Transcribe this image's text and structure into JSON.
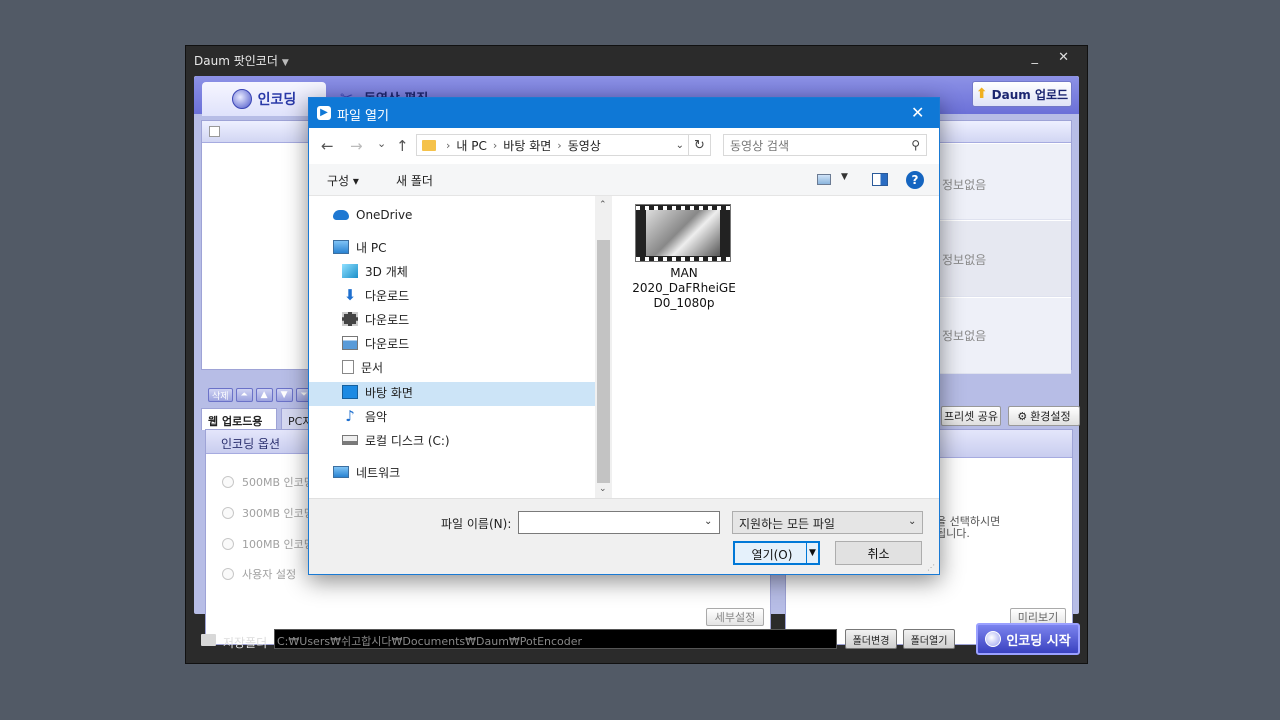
{
  "app": {
    "title": "Daum 팟인코더",
    "title_caret": "▼",
    "controls": "_ ✕",
    "tabs": {
      "encoding": "인코딩",
      "edit": "동영상 편집"
    },
    "daum_upload": "Daum 업로드",
    "list_info": [
      "정보없음",
      "정보없음",
      "정보없음"
    ],
    "list_buttons": {
      "delete": "삭제",
      "up_top": "⏶",
      "up": "▲",
      "down": "▼",
      "down_bottom": "⏷"
    },
    "option_tabs": {
      "web_upload": "웹 업로드용",
      "pc": "PC저"
    },
    "options": {
      "title": "인코딩 옵션",
      "radios": [
        "500MB 인코딩",
        "300MB 인코딩",
        "100MB 인코딩",
        "사용자 설정"
      ],
      "detail_button": "세부설정"
    },
    "preview": {
      "text_line1": "을 선택하시면",
      "text_line2": "됩니다.",
      "button": "미리보기"
    },
    "preset_share": "프리셋 공유",
    "settings": "환경설정",
    "save_folder_label": "저장폴더",
    "save_path": "C:₩Users₩쉬고합시다₩Documents₩Daum₩PotEncoder",
    "change_folder": "폴더변경",
    "open_folder": "폴더열기",
    "start_encoding": "인코딩 시작"
  },
  "dialog": {
    "title": "파일 열기",
    "close": "✕",
    "nav": {
      "back": "←",
      "forward": "→",
      "recent": "⌄",
      "up": "↑"
    },
    "breadcrumb": [
      "내 PC",
      "바탕 화면",
      "동영상"
    ],
    "search_placeholder": "동영상 검색",
    "toolbar": {
      "organize": "구성 ▾",
      "new_folder": "새 폴더",
      "view_dd": "▼",
      "help": "?"
    },
    "tree": [
      {
        "label": "OneDrive",
        "icon": "cloud-icon"
      },
      {
        "label": "내 PC",
        "icon": "computer-icon"
      },
      {
        "label": "3D 개체",
        "icon": "cube-icon"
      },
      {
        "label": "다운로드",
        "icon": "download-icon"
      },
      {
        "label": "다운로드",
        "icon": "film-icon"
      },
      {
        "label": "다운로드",
        "icon": "picture-icon"
      },
      {
        "label": "문서",
        "icon": "document-icon"
      },
      {
        "label": "바탕 화면",
        "icon": "desktop-icon"
      },
      {
        "label": "음악",
        "icon": "music-icon"
      },
      {
        "label": "로컬 디스크 (C:)",
        "icon": "drive-icon"
      },
      {
        "label": "네트워크",
        "icon": "network-icon"
      }
    ],
    "selected_tree_item": "바탕 화면",
    "file": {
      "name_line1": "MAN",
      "name_line2": "2020_DaFRheiGE",
      "name_line3": "D0_1080p"
    },
    "filename_label": "파일 이름(N):",
    "filename_value": "",
    "filetype": "지원하는 모든 파일",
    "open_button": "열기(O)",
    "cancel_button": "취소"
  },
  "colors": {
    "dialog_title": "#0f78d6",
    "selected": "#cce4f7",
    "app_accent": "#6b70d8"
  }
}
